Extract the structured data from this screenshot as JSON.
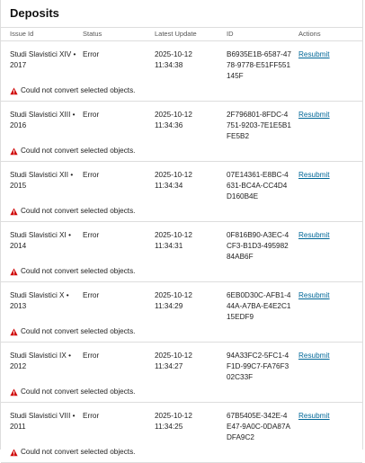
{
  "panel": {
    "title": "Deposits"
  },
  "columns": {
    "issue_id": "Issue Id",
    "status": "Status",
    "latest_update": "Latest Update",
    "id": "ID",
    "actions": "Actions"
  },
  "deposits": [
    {
      "issue": "Studi Slavistici XIV • 2017",
      "status": "Error",
      "date": "2025-10-12",
      "time": "11:34:38",
      "id": "B6935E1B-6587-4778-9778-E51FF551145F",
      "action": "Resubmit",
      "error": "Could not convert selected objects."
    },
    {
      "issue": "Studi Slavistici XIII • 2016",
      "status": "Error",
      "date": "2025-10-12",
      "time": "11:34:36",
      "id": "2F796801-8FDC-4751-9203-7E1E5B1FE5B2",
      "action": "Resubmit",
      "error": "Could not convert selected objects."
    },
    {
      "issue": "Studi Slavistici XII • 2015",
      "status": "Error",
      "date": "2025-10-12",
      "time": "11:34:34",
      "id": "07E14361-E8BC-4631-BC4A-CC4D4D160B4E",
      "action": "Resubmit",
      "error": "Could not convert selected objects."
    },
    {
      "issue": "Studi Slavistici XI • 2014",
      "status": "Error",
      "date": "2025-10-12",
      "time": "11:34:31",
      "id": "0F816B90-A3EC-4CF3-B1D3-49598284AB6F",
      "action": "Resubmit",
      "error": "Could not convert selected objects."
    },
    {
      "issue": "Studi Slavistici X • 2013",
      "status": "Error",
      "date": "2025-10-12",
      "time": "11:34:29",
      "id": "6EB0D30C-AFB1-444A-A7BA-E4E2C115EDF9",
      "action": "Resubmit",
      "error": "Could not convert selected objects."
    },
    {
      "issue": "Studi Slavistici IX • 2012",
      "status": "Error",
      "date": "2025-10-12",
      "time": "11:34:27",
      "id": "94A33FC2-5FC1-4F1D-99C7-FA76F302C33F",
      "action": "Resubmit",
      "error": "Could not convert selected objects."
    },
    {
      "issue": "Studi Slavistici VIII • 2011",
      "status": "Error",
      "date": "2025-10-12",
      "time": "11:34:25",
      "id": "67B5405E-342E-4E47-9A0C-0DA87ADFA9C2",
      "action": "Resubmit",
      "error": "Could not convert selected objects."
    }
  ],
  "colors": {
    "link": "#006798",
    "error_icon": "#d00a0a",
    "border": "#dddddd"
  },
  "icons": {
    "error": "warning-triangle-icon"
  }
}
